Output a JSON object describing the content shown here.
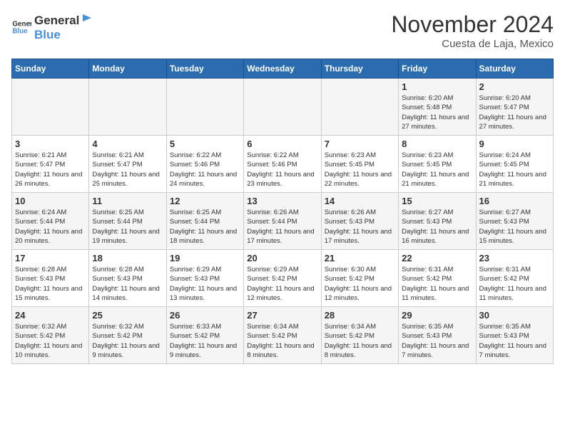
{
  "header": {
    "logo_general": "General",
    "logo_blue": "Blue",
    "month_title": "November 2024",
    "location": "Cuesta de Laja, Mexico"
  },
  "weekdays": [
    "Sunday",
    "Monday",
    "Tuesday",
    "Wednesday",
    "Thursday",
    "Friday",
    "Saturday"
  ],
  "weeks": [
    [
      {
        "day": "",
        "info": ""
      },
      {
        "day": "",
        "info": ""
      },
      {
        "day": "",
        "info": ""
      },
      {
        "day": "",
        "info": ""
      },
      {
        "day": "",
        "info": ""
      },
      {
        "day": "1",
        "info": "Sunrise: 6:20 AM\nSunset: 5:48 PM\nDaylight: 11 hours and 27 minutes."
      },
      {
        "day": "2",
        "info": "Sunrise: 6:20 AM\nSunset: 5:47 PM\nDaylight: 11 hours and 27 minutes."
      }
    ],
    [
      {
        "day": "3",
        "info": "Sunrise: 6:21 AM\nSunset: 5:47 PM\nDaylight: 11 hours and 26 minutes."
      },
      {
        "day": "4",
        "info": "Sunrise: 6:21 AM\nSunset: 5:47 PM\nDaylight: 11 hours and 25 minutes."
      },
      {
        "day": "5",
        "info": "Sunrise: 6:22 AM\nSunset: 5:46 PM\nDaylight: 11 hours and 24 minutes."
      },
      {
        "day": "6",
        "info": "Sunrise: 6:22 AM\nSunset: 5:46 PM\nDaylight: 11 hours and 23 minutes."
      },
      {
        "day": "7",
        "info": "Sunrise: 6:23 AM\nSunset: 5:45 PM\nDaylight: 11 hours and 22 minutes."
      },
      {
        "day": "8",
        "info": "Sunrise: 6:23 AM\nSunset: 5:45 PM\nDaylight: 11 hours and 21 minutes."
      },
      {
        "day": "9",
        "info": "Sunrise: 6:24 AM\nSunset: 5:45 PM\nDaylight: 11 hours and 21 minutes."
      }
    ],
    [
      {
        "day": "10",
        "info": "Sunrise: 6:24 AM\nSunset: 5:44 PM\nDaylight: 11 hours and 20 minutes."
      },
      {
        "day": "11",
        "info": "Sunrise: 6:25 AM\nSunset: 5:44 PM\nDaylight: 11 hours and 19 minutes."
      },
      {
        "day": "12",
        "info": "Sunrise: 6:25 AM\nSunset: 5:44 PM\nDaylight: 11 hours and 18 minutes."
      },
      {
        "day": "13",
        "info": "Sunrise: 6:26 AM\nSunset: 5:44 PM\nDaylight: 11 hours and 17 minutes."
      },
      {
        "day": "14",
        "info": "Sunrise: 6:26 AM\nSunset: 5:43 PM\nDaylight: 11 hours and 17 minutes."
      },
      {
        "day": "15",
        "info": "Sunrise: 6:27 AM\nSunset: 5:43 PM\nDaylight: 11 hours and 16 minutes."
      },
      {
        "day": "16",
        "info": "Sunrise: 6:27 AM\nSunset: 5:43 PM\nDaylight: 11 hours and 15 minutes."
      }
    ],
    [
      {
        "day": "17",
        "info": "Sunrise: 6:28 AM\nSunset: 5:43 PM\nDaylight: 11 hours and 15 minutes."
      },
      {
        "day": "18",
        "info": "Sunrise: 6:28 AM\nSunset: 5:43 PM\nDaylight: 11 hours and 14 minutes."
      },
      {
        "day": "19",
        "info": "Sunrise: 6:29 AM\nSunset: 5:43 PM\nDaylight: 11 hours and 13 minutes."
      },
      {
        "day": "20",
        "info": "Sunrise: 6:29 AM\nSunset: 5:42 PM\nDaylight: 11 hours and 12 minutes."
      },
      {
        "day": "21",
        "info": "Sunrise: 6:30 AM\nSunset: 5:42 PM\nDaylight: 11 hours and 12 minutes."
      },
      {
        "day": "22",
        "info": "Sunrise: 6:31 AM\nSunset: 5:42 PM\nDaylight: 11 hours and 11 minutes."
      },
      {
        "day": "23",
        "info": "Sunrise: 6:31 AM\nSunset: 5:42 PM\nDaylight: 11 hours and 11 minutes."
      }
    ],
    [
      {
        "day": "24",
        "info": "Sunrise: 6:32 AM\nSunset: 5:42 PM\nDaylight: 11 hours and 10 minutes."
      },
      {
        "day": "25",
        "info": "Sunrise: 6:32 AM\nSunset: 5:42 PM\nDaylight: 11 hours and 9 minutes."
      },
      {
        "day": "26",
        "info": "Sunrise: 6:33 AM\nSunset: 5:42 PM\nDaylight: 11 hours and 9 minutes."
      },
      {
        "day": "27",
        "info": "Sunrise: 6:34 AM\nSunset: 5:42 PM\nDaylight: 11 hours and 8 minutes."
      },
      {
        "day": "28",
        "info": "Sunrise: 6:34 AM\nSunset: 5:42 PM\nDaylight: 11 hours and 8 minutes."
      },
      {
        "day": "29",
        "info": "Sunrise: 6:35 AM\nSunset: 5:43 PM\nDaylight: 11 hours and 7 minutes."
      },
      {
        "day": "30",
        "info": "Sunrise: 6:35 AM\nSunset: 5:43 PM\nDaylight: 11 hours and 7 minutes."
      }
    ]
  ]
}
